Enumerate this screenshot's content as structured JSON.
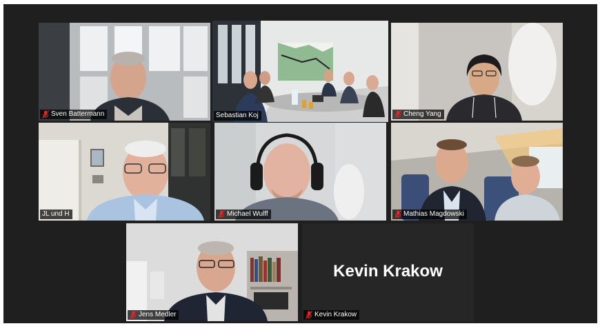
{
  "app": {
    "accent_color": "#c6dc3c",
    "muted_icon": "muted-microphone-icon",
    "muted_icon_color": "#e02828"
  },
  "participants": [
    {
      "name": "Sven Battermann",
      "muted": true,
      "video": true
    },
    {
      "name": "Sebastian Koj",
      "muted": false,
      "video": true,
      "active_speaker": true
    },
    {
      "name": "Cheng Yang",
      "muted": true,
      "video": true
    },
    {
      "name": "JL und H",
      "muted": false,
      "video": true
    },
    {
      "name": "Michael Wulff",
      "muted": true,
      "video": true
    },
    {
      "name": "Mathias Magdowski",
      "muted": true,
      "video": true
    },
    {
      "name": "Jens Medler",
      "muted": true,
      "video": true
    },
    {
      "name": "Kevin Krakow",
      "muted": true,
      "video": false,
      "display_name": "Kevin Krakow"
    }
  ]
}
